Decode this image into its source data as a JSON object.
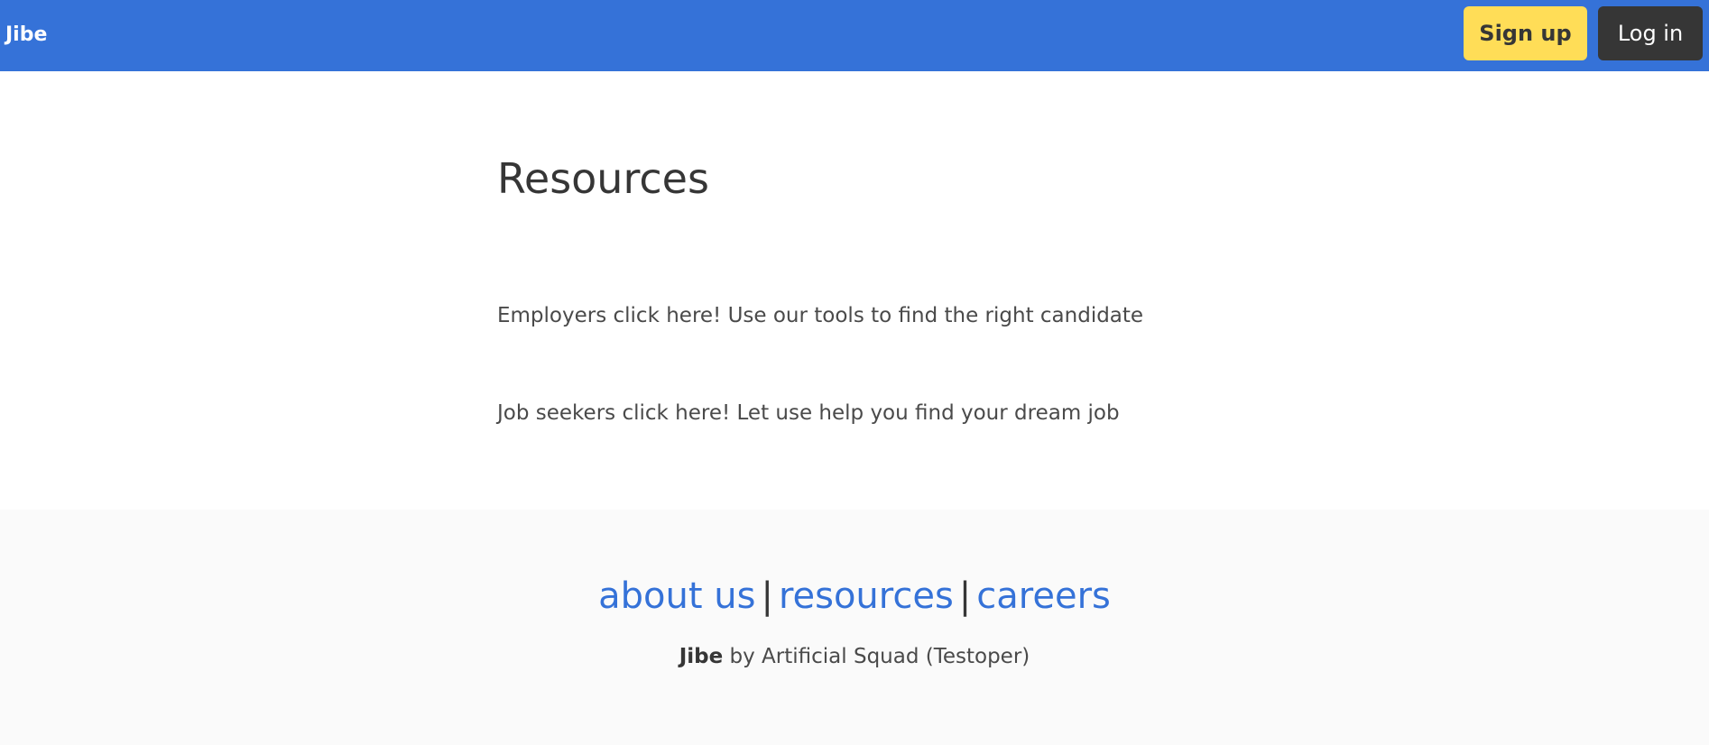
{
  "navbar": {
    "brand": "Jibe",
    "signup_label": "Sign up",
    "login_label": "Log in"
  },
  "main": {
    "title": "Resources",
    "links": [
      "Employers click here! Use our tools to find the right candidate",
      "Job seekers click here! Let use help you find your dream job"
    ]
  },
  "footer": {
    "nav": [
      "about us",
      "resources",
      "careers"
    ],
    "separator": "|",
    "credit_brand": "Jibe",
    "credit_text": " by Artificial Squad (Testoper)"
  },
  "colors": {
    "navbar_bg": "#3572d8",
    "signup_bg": "#ffdd57",
    "login_bg": "#363636",
    "link": "#3572d8",
    "footer_bg": "#fafafa"
  }
}
